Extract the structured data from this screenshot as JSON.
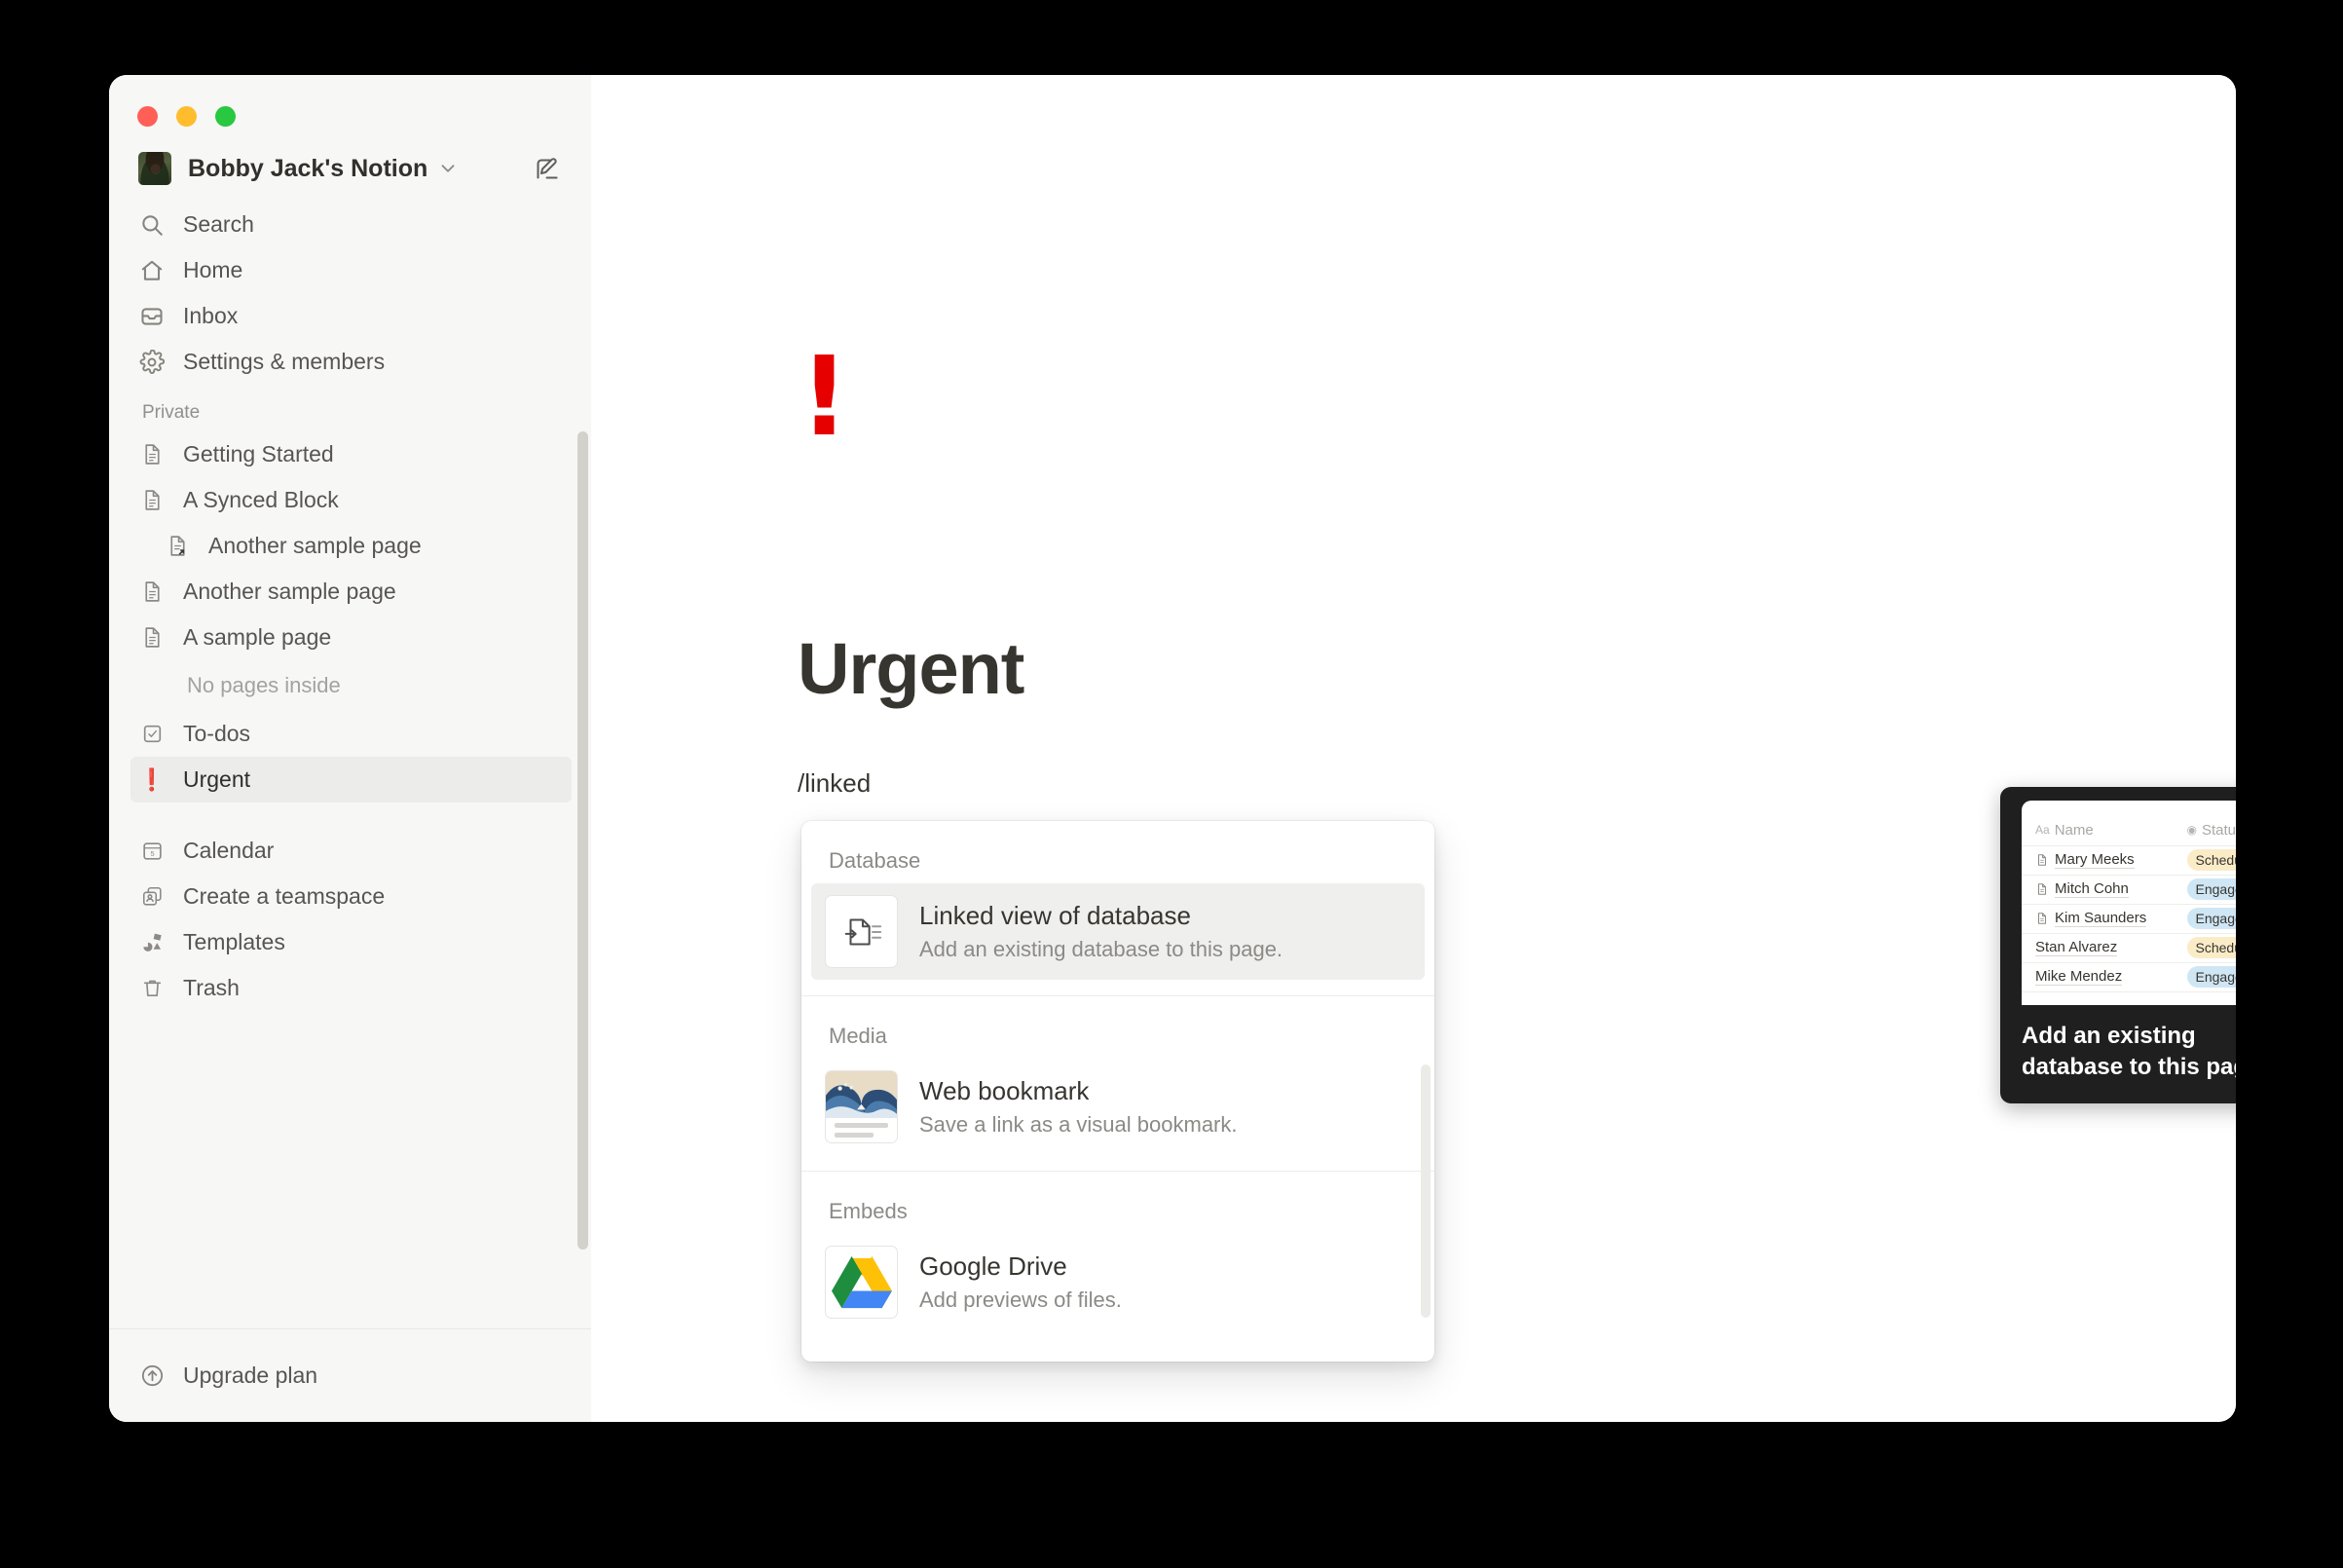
{
  "window": {
    "traffic_lights": [
      "close",
      "minimize",
      "zoom"
    ],
    "colors": {
      "close": "#ff5f57",
      "minimize": "#ffbd2e",
      "zoom": "#28c840",
      "accent_red": "#e60000"
    }
  },
  "sidebar": {
    "workspace": {
      "name": "Bobby Jack's Notion",
      "chevron_icon": "chevron-down-icon",
      "compose_icon": "compose-icon",
      "avatar_icon": "avatar"
    },
    "nav": [
      {
        "label": "Search",
        "icon": "search-icon"
      },
      {
        "label": "Home",
        "icon": "home-icon"
      },
      {
        "label": "Inbox",
        "icon": "inbox-icon"
      },
      {
        "label": "Settings & members",
        "icon": "gear-icon"
      }
    ],
    "private_label": "Private",
    "pages": [
      {
        "label": "Getting Started",
        "icon": "page-icon",
        "indent": false,
        "selected": false
      },
      {
        "label": "A Synced Block",
        "icon": "page-icon",
        "indent": false,
        "selected": false
      },
      {
        "label": "Another sample page",
        "icon": "page-link-icon",
        "indent": true,
        "selected": false
      },
      {
        "label": "Another sample page",
        "icon": "page-icon",
        "indent": false,
        "selected": false
      },
      {
        "label": "A sample page",
        "icon": "page-icon",
        "indent": false,
        "selected": false
      }
    ],
    "empty_note": "No pages inside",
    "pages_after": [
      {
        "label": "To-dos",
        "icon": "checkbox-icon",
        "indent": false,
        "selected": false
      },
      {
        "label": "Urgent",
        "icon": "exclamation-emoji",
        "indent": false,
        "selected": true
      }
    ],
    "tools": [
      {
        "label": "Calendar",
        "icon": "calendar-icon"
      },
      {
        "label": "Create a teamspace",
        "icon": "teamspace-icon"
      },
      {
        "label": "Templates",
        "icon": "templates-icon"
      },
      {
        "label": "Trash",
        "icon": "trash-icon"
      }
    ],
    "footer": {
      "label": "Upgrade plan",
      "icon": "upgrade-arrow-icon"
    }
  },
  "main": {
    "page_emoji": "!",
    "page_title": "Urgent",
    "slash_text": "/linked"
  },
  "slash_menu": {
    "sections": [
      {
        "label": "Database",
        "items": [
          {
            "title": "Linked view of database",
            "subtitle": "Add an existing database to this page.",
            "icon": "linked-database-icon",
            "active": true
          }
        ]
      },
      {
        "label": "Media",
        "items": [
          {
            "title": "Web bookmark",
            "subtitle": "Save a link as a visual bookmark.",
            "icon": "great-wave-thumbnail",
            "active": false
          }
        ]
      },
      {
        "label": "Embeds",
        "items": [
          {
            "title": "Google Drive",
            "subtitle": "Add previews of files.",
            "icon": "google-drive-icon",
            "active": false
          }
        ]
      }
    ]
  },
  "preview_popover": {
    "tooltip_text": "Add an existing database to this page.",
    "table": {
      "columns": [
        {
          "label": "Name",
          "icon": "text-type-icon"
        },
        {
          "label": "Status",
          "icon": "select-type-icon"
        }
      ],
      "rows": [
        {
          "name": "Mary Meeks",
          "has_icon": true,
          "status": "Scheduled",
          "status_class": "scheduled"
        },
        {
          "name": "Mitch Cohn",
          "has_icon": true,
          "status": "Engaged",
          "status_class": "engaged"
        },
        {
          "name": "Kim Saunders",
          "has_icon": true,
          "status": "Engaged",
          "status_class": "engaged"
        },
        {
          "name": "Stan Alvarez",
          "has_icon": false,
          "status": "Scheduled",
          "status_class": "scheduled"
        },
        {
          "name": "Mike Mendez",
          "has_icon": false,
          "status": "Engaged",
          "status_class": "engaged"
        }
      ]
    }
  }
}
